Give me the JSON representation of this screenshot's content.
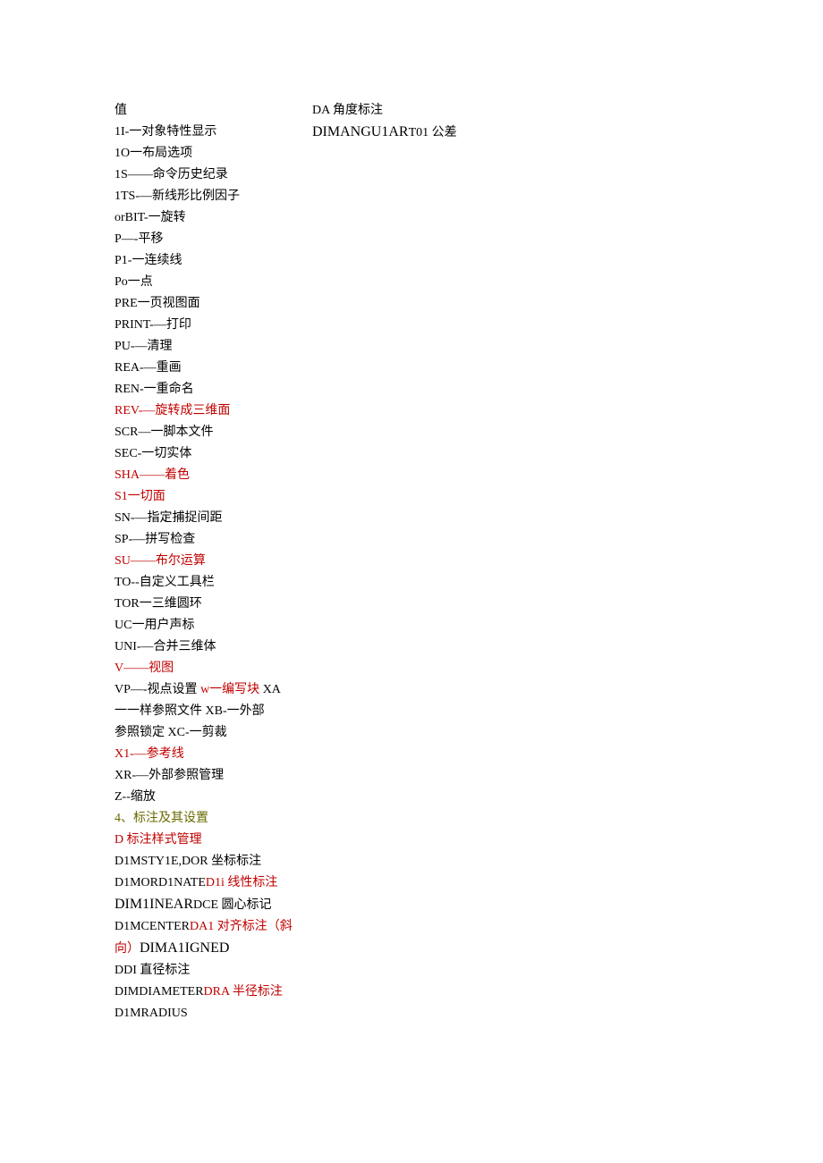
{
  "col1": [
    {
      "parts": [
        {
          "text": "值",
          "cls": "black"
        }
      ]
    },
    {
      "parts": [
        {
          "text": "1I-一对象特性显示",
          "cls": "black"
        }
      ]
    },
    {
      "parts": [
        {
          "text": "1O一布局选项",
          "cls": "black"
        }
      ]
    },
    {
      "parts": [
        {
          "text": "1S——命令历史纪录",
          "cls": "black"
        }
      ]
    },
    {
      "parts": [
        {
          "text": "1TS-—新线形比例因子",
          "cls": "black"
        }
      ]
    },
    {
      "parts": [
        {
          "text": "orBIT-一旋转",
          "cls": "black"
        }
      ]
    },
    {
      "parts": [
        {
          "text": "P—-平移",
          "cls": "black"
        }
      ]
    },
    {
      "parts": [
        {
          "text": "P1-一连续线",
          "cls": "black"
        }
      ]
    },
    {
      "parts": [
        {
          "text": "Po一点",
          "cls": "black"
        }
      ]
    },
    {
      "parts": [
        {
          "text": "PRE一页视图面",
          "cls": "black"
        }
      ]
    },
    {
      "parts": [
        {
          "text": "PRINT-—打印",
          "cls": "black"
        }
      ]
    },
    {
      "parts": [
        {
          "text": "PU-—清理",
          "cls": "black"
        }
      ]
    },
    {
      "parts": [
        {
          "text": "REA-—重画",
          "cls": "black"
        }
      ]
    },
    {
      "parts": [
        {
          "text": "REN-一重命名",
          "cls": "black"
        }
      ]
    },
    {
      "parts": [
        {
          "text": "REV-—旋转成三维面",
          "cls": "red"
        }
      ]
    },
    {
      "parts": [
        {
          "text": "SCR—一脚本文件",
          "cls": "black"
        }
      ]
    },
    {
      "parts": [
        {
          "text": "SEC-一切实体",
          "cls": "black"
        }
      ]
    },
    {
      "parts": [
        {
          "text": "SHA——着色",
          "cls": "red"
        }
      ]
    },
    {
      "parts": [
        {
          "text": "S1一切面",
          "cls": "red"
        }
      ]
    },
    {
      "parts": [
        {
          "text": "SN-—指定捕捉间距",
          "cls": "black"
        }
      ]
    },
    {
      "parts": [
        {
          "text": "SP-—拼写检查",
          "cls": "black"
        }
      ]
    },
    {
      "parts": [
        {
          "text": "SU——布尔运算",
          "cls": "red"
        }
      ]
    },
    {
      "parts": [
        {
          "text": "TO--自定义工具栏",
          "cls": "black"
        }
      ]
    },
    {
      "parts": [
        {
          "text": "TOR一三维圆环",
          "cls": "black"
        }
      ]
    },
    {
      "parts": [
        {
          "text": "UC一用户声标",
          "cls": "black"
        }
      ]
    },
    {
      "parts": [
        {
          "text": "UNI-—合并三维体",
          "cls": "black"
        }
      ]
    },
    {
      "parts": [
        {
          "text": "V——视图",
          "cls": "red"
        }
      ]
    },
    {
      "parts": [
        {
          "text": "VP—-视点设置 ",
          "cls": "black"
        },
        {
          "text": "w一编写块",
          "cls": "red"
        },
        {
          "text": " XA",
          "cls": "black"
        }
      ]
    },
    {
      "parts": [
        {
          "text": "一一样参照文件 XB-一外部",
          "cls": "black"
        }
      ]
    },
    {
      "parts": [
        {
          "text": "参照锁定 XC-一剪裁",
          "cls": "black"
        }
      ]
    },
    {
      "parts": [
        {
          "text": "X1-—参考线",
          "cls": "red"
        }
      ]
    },
    {
      "parts": [
        {
          "text": "XR-—外部参照管理",
          "cls": "black"
        }
      ]
    },
    {
      "parts": [
        {
          "text": "Z--缩放",
          "cls": "black"
        }
      ]
    },
    {
      "parts": [
        {
          "text": "4、标注及其设置",
          "cls": "olive"
        }
      ]
    },
    {
      "parts": [
        {
          "text": "D 标注样式管理",
          "cls": "red"
        }
      ]
    },
    {
      "parts": [
        {
          "text": "D1MSTY1E,DOR 坐标标注",
          "cls": "black"
        }
      ]
    },
    {
      "parts": [
        {
          "text": "D1MORD1NATE",
          "cls": "black"
        },
        {
          "text": "D1i 线性标注",
          "cls": "red"
        }
      ]
    },
    {
      "parts": [
        {
          "text": "DIM1INEAR",
          "cls": "black times"
        },
        {
          "text": "DCE 圆心标记",
          "cls": "black"
        }
      ]
    },
    {
      "parts": [
        {
          "text": "D1MCENTER",
          "cls": "black"
        },
        {
          "text": "DA1 对齐标注（斜",
          "cls": "red"
        }
      ]
    },
    {
      "parts": [
        {
          "text": "向）",
          "cls": "red"
        },
        {
          "text": "DIMA1IGNED",
          "cls": "black times"
        }
      ]
    },
    {
      "parts": [
        {
          "text": "DDI 直径标注",
          "cls": "black"
        }
      ]
    },
    {
      "parts": [
        {
          "text": "DIMDIAMETER",
          "cls": "black"
        },
        {
          "text": "DRA 半径标注",
          "cls": "red"
        }
      ]
    },
    {
      "parts": [
        {
          "text": "D1MRADIUS",
          "cls": "black"
        }
      ]
    }
  ],
  "col2": [
    {
      "parts": [
        {
          "text": "DA 角度标注",
          "cls": "black"
        }
      ]
    },
    {
      "parts": [
        {
          "text": "DIMANGU1AR",
          "cls": "black times"
        },
        {
          "text": "T01 公差",
          "cls": "black"
        }
      ]
    }
  ]
}
